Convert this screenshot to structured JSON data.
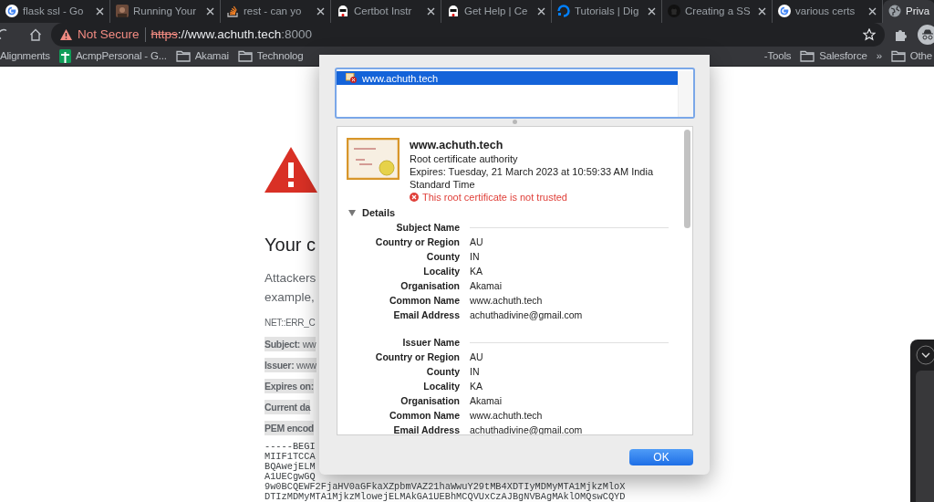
{
  "tabs": [
    {
      "title": "flask ssl - Go",
      "kind": "google",
      "selected": false
    },
    {
      "title": "Running Your",
      "kind": "photo",
      "selected": false
    },
    {
      "title": "rest - can yo",
      "kind": "stack",
      "selected": false
    },
    {
      "title": "Certbot Instr",
      "kind": "ghost",
      "selected": false
    },
    {
      "title": "Get Help | Ce",
      "kind": "ghost",
      "selected": false
    },
    {
      "title": "Tutorials | Dig",
      "kind": "ring",
      "selected": false
    },
    {
      "title": "Creating a SS",
      "kind": "github",
      "selected": false
    },
    {
      "title": "various certs",
      "kind": "google",
      "selected": false
    },
    {
      "title": "Priva",
      "kind": "globe",
      "selected": true
    }
  ],
  "address": {
    "security_label": "Not Secure",
    "scheme": "https",
    "host": "://www.achuth.tech",
    "port": ":8000"
  },
  "bookmarks_left": [
    {
      "label": "Alignments",
      "kind": "plain"
    },
    {
      "label": "AcmpPersonal - G...",
      "kind": "sheet"
    },
    {
      "label": "Akamai",
      "kind": "folder"
    },
    {
      "label": "Technolog",
      "kind": "folder"
    }
  ],
  "bookmarks_right": [
    {
      "label": "-Tools",
      "kind": "plain"
    },
    {
      "label": "Salesforce",
      "kind": "folder"
    },
    {
      "label": "»",
      "kind": "plain"
    },
    {
      "label": "Othe",
      "kind": "folder"
    }
  ],
  "page": {
    "heading": "Your c",
    "paragraph": [
      "Attackers",
      "example,"
    ],
    "error_code": "NET::ERR_C",
    "fields": [
      "**Subject:** ww",
      "**Issuer:** www",
      "**Expires on:**",
      "**Current da**",
      "**PEM encod**"
    ],
    "pem_lines": [
      "-----BEGI",
      "MIIF1TCCA",
      "BQAwejELM",
      "A1UECgwGQ",
      "9w0BCQEWF2FjaHV0aGFkaXZpbmVAZ21haWwuY29tMB4XDTIyMDMyMTA1MjkzMloX",
      "DTIzMDMyMTA1MjkzMlowejELMAkGA1UEBhMCQVUxCzAJBgNVBAgMAklOMQswCQYD"
    ]
  },
  "dialog": {
    "certificates": [
      {
        "label": "www.achuth.tech",
        "selected": true
      }
    ],
    "cert": {
      "name": "www.achuth.tech",
      "type": "Root certificate authority",
      "expires": "Expires: Tuesday, 21 March 2023 at 10:59:33 AM India Standard Time",
      "trust_error": "This root certificate is not trusted"
    },
    "details": {
      "label": "Details",
      "expanded": true
    },
    "sections": [
      {
        "title": "Subject Name",
        "rows": [
          {
            "label": "Country or Region",
            "value": "AU"
          },
          {
            "label": "County",
            "value": "IN"
          },
          {
            "label": "Locality",
            "value": "KA"
          },
          {
            "label": "Organisation",
            "value": "Akamai"
          },
          {
            "label": "Common Name",
            "value": "www.achuth.tech"
          },
          {
            "label": "Email Address",
            "value": "achuthadivine@gmail.com"
          }
        ]
      },
      {
        "title": "Issuer Name",
        "rows": [
          {
            "label": "Country or Region",
            "value": "AU"
          },
          {
            "label": "County",
            "value": "IN"
          },
          {
            "label": "Locality",
            "value": "KA"
          },
          {
            "label": "Organisation",
            "value": "Akamai"
          },
          {
            "label": "Common Name",
            "value": "www.achuth.tech"
          },
          {
            "label": "Email Address",
            "value": "achuthadivine@gmail.com"
          }
        ]
      }
    ],
    "ok_button": "OK"
  }
}
